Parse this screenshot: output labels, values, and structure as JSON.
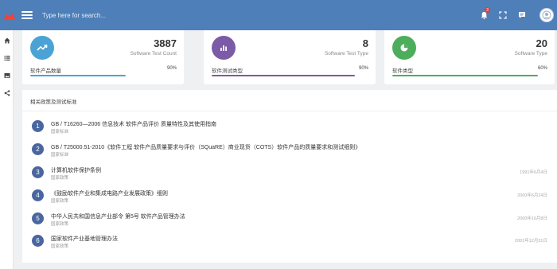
{
  "header": {
    "search_placeholder": "Type here for search...",
    "notification_count": "3"
  },
  "sidebar": {
    "items": [
      {
        "icon": "home-icon"
      },
      {
        "icon": "list-icon"
      },
      {
        "icon": "image-icon"
      },
      {
        "icon": "share-icon"
      }
    ]
  },
  "stats": [
    {
      "value": "3887",
      "subtitle": "Software Test Count",
      "label": "软件产品数量",
      "percent": "90%",
      "progress": 0.9,
      "color": "#4aa3d4",
      "icon": "trend-up-icon"
    },
    {
      "value": "8",
      "subtitle": "Software Test Type",
      "label": "软件测试类型",
      "percent": "90%",
      "progress": 0.9,
      "color": "#7b5aa6",
      "icon": "bar-chart-icon"
    },
    {
      "value": "20",
      "subtitle": "Software Type",
      "label": "软件类型",
      "percent": "60%",
      "progress": 0.6,
      "color": "#4cae5a",
      "icon": "pie-chart-icon"
    }
  ],
  "panel": {
    "title": "相关政策及测试标准",
    "items": [
      {
        "num": "1",
        "title": "GB / T16260—2006 信息技术 软件产品评价 质量特性及其使用指南",
        "category": "国家标准",
        "date": ""
      },
      {
        "num": "2",
        "title": "GB / T25000.51-2010《软件工程 软件产品质量要求与评价（SQuaRE）商业现货（COTS）软件产品的质量要求和测试细则》",
        "category": "国家标准",
        "date": ""
      },
      {
        "num": "3",
        "title": "计算机软件保护条例",
        "category": "国家政策",
        "date": "1991年6月4日"
      },
      {
        "num": "4",
        "title": "《鼓励软件产业和集成电路产业发展政策》细则",
        "category": "国家政策",
        "date": "2000年6月24日"
      },
      {
        "num": "5",
        "title": "中华人民共和国信息产业部令 第5号 软件产品管理办法",
        "category": "国家政策",
        "date": "2000年10月8日"
      },
      {
        "num": "6",
        "title": "国家软件产业基地管理办法",
        "category": "国家政策",
        "date": "2001年12月31日"
      }
    ]
  }
}
